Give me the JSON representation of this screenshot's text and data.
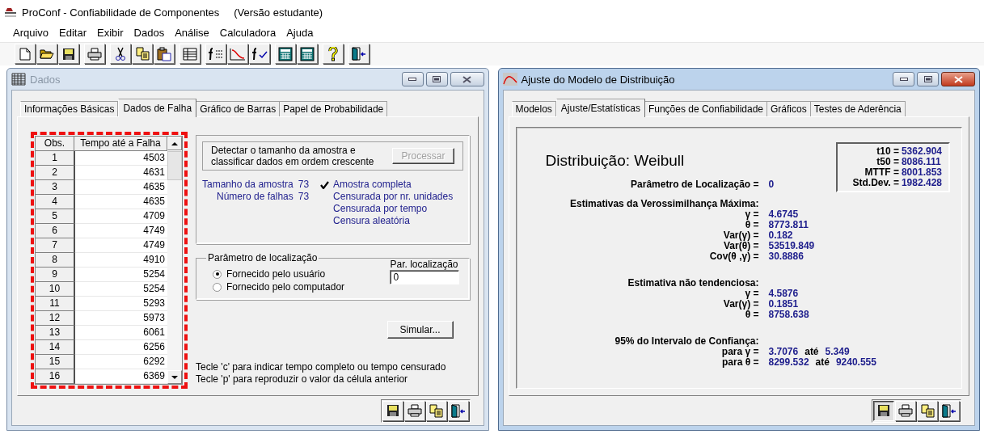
{
  "window": {
    "title": "ProConf - Confiabilidade de Componentes",
    "edition": "(Versão estudante)"
  },
  "menu": [
    "Arquivo",
    "Editar",
    "Exibir",
    "Dados",
    "Análise",
    "Calculadora",
    "Ajuda"
  ],
  "toolbar": [
    [
      {
        "kind": "new"
      },
      {
        "kind": "open"
      },
      {
        "kind": "save"
      }
    ],
    [
      {
        "kind": "print"
      }
    ],
    [
      {
        "kind": "cut"
      },
      {
        "kind": "copy"
      },
      {
        "kind": "paste"
      }
    ],
    [
      {
        "kind": "table"
      }
    ],
    [
      {
        "kind": "flist"
      },
      {
        "kind": "curve"
      },
      {
        "kind": "fcheck"
      }
    ],
    [
      {
        "kind": "calc"
      },
      {
        "kind": "calc"
      }
    ],
    [
      {
        "kind": "help"
      }
    ],
    [
      {
        "kind": "exit"
      }
    ]
  ],
  "dados_window": {
    "title": "Dados",
    "active": false,
    "tabs": [
      {
        "label": "Informações Básicas",
        "selected": false
      },
      {
        "label": "Dados de Falha",
        "selected": true
      },
      {
        "label": "Gráfico de Barras",
        "selected": false
      },
      {
        "label": "Papel de Probabilidade",
        "selected": false
      }
    ],
    "table": {
      "columns": [
        "Obs.",
        "Tempo até a Falha"
      ],
      "rows": [
        {
          "obs": "1",
          "time": "4503"
        },
        {
          "obs": "2",
          "time": "4631"
        },
        {
          "obs": "3",
          "time": "4635"
        },
        {
          "obs": "4",
          "time": "4635"
        },
        {
          "obs": "5",
          "time": "4709"
        },
        {
          "obs": "6",
          "time": "4749"
        },
        {
          "obs": "7",
          "time": "4749"
        },
        {
          "obs": "8",
          "time": "4910"
        },
        {
          "obs": "9",
          "time": "5254"
        },
        {
          "obs": "10",
          "time": "5254"
        },
        {
          "obs": "11",
          "time": "5293"
        },
        {
          "obs": "12",
          "time": "5973"
        },
        {
          "obs": "13",
          "time": "6061"
        },
        {
          "obs": "14",
          "time": "6256"
        },
        {
          "obs": "15",
          "time": "6292"
        },
        {
          "obs": "16",
          "time": "6369"
        }
      ]
    },
    "detect_text": "Detectar o tamanho da amostra e classificar dados em ordem crescente",
    "process_button": {
      "label": "Processar",
      "disabled": true
    },
    "stats": [
      {
        "label": "Tamanho da amostra",
        "value": "73"
      },
      {
        "label": "Número de falhas",
        "value": "73"
      }
    ],
    "sample_types": [
      {
        "label": "Amostra completa",
        "checked": true
      },
      {
        "label": "Censurada por nr. unidades",
        "checked": false
      },
      {
        "label": "Censurada por tempo",
        "checked": false
      },
      {
        "label": "Censura aleatória",
        "checked": false
      }
    ],
    "location": {
      "title": "Parâmetro de localização",
      "options": [
        {
          "label": "Fornecido pelo usuário",
          "selected": true
        },
        {
          "label": "Fornecido pelo computador",
          "selected": false
        }
      ],
      "field_label": "Par. localização",
      "field_value": "0"
    },
    "simulate_button": "Simular...",
    "hints": [
      "Tecle 'c' para indicar tempo completo ou tempo censurado",
      "Tecle 'p' para reproduzir o valor da célula anterior"
    ],
    "footer_buttons": [
      {
        "kind": "save",
        "pressed": false
      },
      {
        "kind": "print",
        "pressed": false
      },
      {
        "kind": "copy",
        "pressed": false
      },
      {
        "kind": "exit",
        "pressed": false
      }
    ]
  },
  "fit_window": {
    "title": "Ajuste do Modelo de Distribuição",
    "active": true,
    "tabs": [
      {
        "label": "Modelos",
        "selected": false
      },
      {
        "label": "Ajuste/Estatísticas",
        "selected": true
      },
      {
        "label": "Funções de Confiabilidade",
        "selected": false
      },
      {
        "label": "Gráficos",
        "selected": false
      },
      {
        "label": "Testes de Aderência",
        "selected": false
      }
    ],
    "heading": "Distribuição: Weibull",
    "summary": [
      {
        "label": "t10 =",
        "value": "5362.904"
      },
      {
        "label": "t50 =",
        "value": "8086.111"
      },
      {
        "label": "MTTF =",
        "value": "8001.853"
      },
      {
        "label": "Std.Dev. =",
        "value": "1982.428"
      }
    ],
    "location": {
      "label": "Parâmetro de Localização =",
      "value": "0"
    },
    "sections": [
      {
        "title": "Estimativas da Verossimilhança Máxima:",
        "rows": [
          {
            "label": "γ =",
            "value": "4.6745"
          },
          {
            "label": "θ =",
            "value": "8773.811"
          },
          {
            "label": "Var(γ) =",
            "value": "0.182"
          },
          {
            "label": "Var(θ) =",
            "value": "53519.849"
          },
          {
            "label": "Cov(θ ,γ) =",
            "value": "30.8886"
          }
        ]
      },
      {
        "title": "Estimativa não tendenciosa:",
        "rows": [
          {
            "label": "γ =",
            "value": "4.5876"
          },
          {
            "label": "Var(γ) =",
            "value": "0.1851"
          },
          {
            "label": "θ =",
            "value": "8758.638"
          }
        ]
      },
      {
        "title": "95% do Intervalo de Confiança:",
        "rows": [
          {
            "label": "para  γ =",
            "value": "3.7076",
            "sep": "até",
            "upper": "5.349"
          },
          {
            "label": "para  θ =",
            "value": "8299.532",
            "sep": "até",
            "upper": "9240.555"
          }
        ]
      }
    ],
    "footer_buttons": [
      {
        "kind": "save",
        "pressed": true
      },
      {
        "kind": "print",
        "pressed": false
      },
      {
        "kind": "copy",
        "pressed": false
      },
      {
        "kind": "exit",
        "pressed": false
      }
    ]
  }
}
